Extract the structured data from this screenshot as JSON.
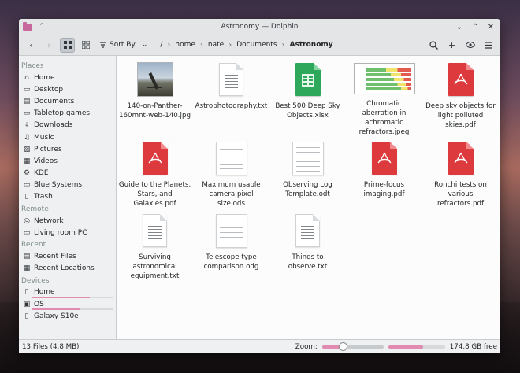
{
  "window": {
    "title": "Astronomy — Dolphin"
  },
  "toolbar": {
    "sort_label": "Sort By",
    "breadcrumbs": [
      "/",
      "home",
      "nate",
      "Documents",
      "Astronomy"
    ]
  },
  "sidebar": {
    "places_header": "Places",
    "places": [
      {
        "label": "Home",
        "icon": "home-icon"
      },
      {
        "label": "Desktop",
        "icon": "desktop-icon"
      },
      {
        "label": "Documents",
        "icon": "documents-icon"
      },
      {
        "label": "Tabletop games",
        "icon": "folder-icon"
      },
      {
        "label": "Downloads",
        "icon": "download-icon"
      },
      {
        "label": "Music",
        "icon": "music-icon"
      },
      {
        "label": "Pictures",
        "icon": "pictures-icon"
      },
      {
        "label": "Videos",
        "icon": "videos-icon"
      },
      {
        "label": "KDE",
        "icon": "kde-icon"
      },
      {
        "label": "Blue Systems",
        "icon": "folder-icon"
      },
      {
        "label": "Trash",
        "icon": "trash-icon"
      }
    ],
    "remote_header": "Remote",
    "remote": [
      {
        "label": "Network",
        "icon": "network-icon"
      },
      {
        "label": "Living room PC",
        "icon": "computer-icon"
      }
    ],
    "recent_header": "Recent",
    "recent": [
      {
        "label": "Recent Files",
        "icon": "recent-files-icon"
      },
      {
        "label": "Recent Locations",
        "icon": "recent-locations-icon"
      }
    ],
    "devices_header": "Devices",
    "devices": [
      {
        "label": "Home",
        "icon": "drive-icon",
        "usage": 0.72
      },
      {
        "label": "OS",
        "icon": "drive-icon",
        "usage": 0.6
      },
      {
        "label": "Galaxy S10e",
        "icon": "phone-icon"
      }
    ]
  },
  "files": [
    {
      "name": "140-on-Panther-160mnt-web-140.jpg",
      "type": "photo"
    },
    {
      "name": "Astrophotography.txt",
      "type": "text"
    },
    {
      "name": "Best 500 Deep Sky Objects.xlsx",
      "type": "xlsx"
    },
    {
      "name": "Chromatic aberration in achromatic refractors.jpeg",
      "type": "chart"
    },
    {
      "name": "Deep sky objects for light polluted skies.pdf",
      "type": "pdf"
    },
    {
      "name": "Guide to the Planets, Stars,  and Galaxies.pdf",
      "type": "pdf"
    },
    {
      "name": "Maximum usable camera pixel size.ods",
      "type": "sheet"
    },
    {
      "name": "Observing Log Template.odt",
      "type": "sheet"
    },
    {
      "name": "Prime-focus imaging.pdf",
      "type": "pdf"
    },
    {
      "name": "Ronchi tests on various refractors.pdf",
      "type": "pdf"
    },
    {
      "name": "Surviving astronomical equipment.txt",
      "type": "text"
    },
    {
      "name": "Telescope type comparison.odg",
      "type": "sheet"
    },
    {
      "name": "Things to observe.txt",
      "type": "text"
    }
  ],
  "status": {
    "summary": "13 Files (4.8 MB)",
    "zoom_label": "Zoom:",
    "zoom_level": 0.33,
    "free_space": "174.8 GB free",
    "space_used": 0.62
  },
  "colors": {
    "accent": "#e28bb0",
    "pdf": "#dc3a3d",
    "xlsx": "#2ea85a"
  }
}
